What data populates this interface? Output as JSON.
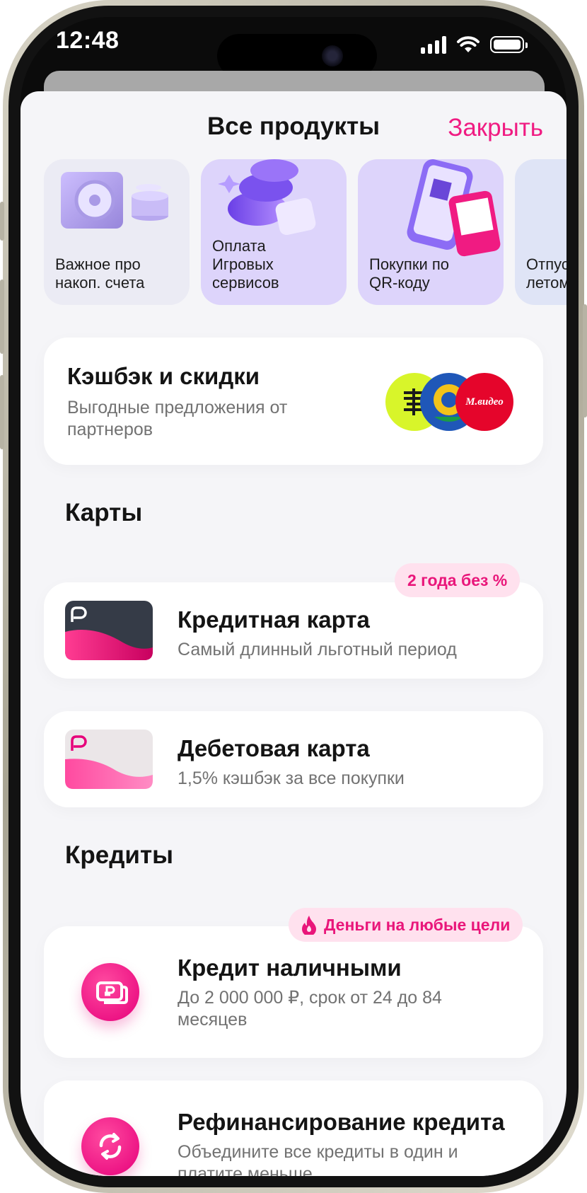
{
  "status_bar": {
    "time": "12:48"
  },
  "sheet": {
    "title": "Все продукты",
    "close_label": "Закрыть"
  },
  "stories": [
    {
      "label": "Важное про\nнакоп. счета",
      "bg": "#ebebf4"
    },
    {
      "label": "Оплата\nИгровых\nсервисов",
      "bg": "#ddd4fb"
    },
    {
      "label": "Покупки по\nQR-коду",
      "bg": "#ddd4fb"
    },
    {
      "label": "Отпуск\nлетом",
      "bg": "#dfe4f6"
    }
  ],
  "cashback": {
    "title": "Кэшбэк и скидки",
    "subtitle": "Выгодные предложения от партнеров",
    "partner_logos": [
      "partner-logo-yellow",
      "partner-logo-blue",
      "mvideo-logo"
    ],
    "mvideo_text": "М.видео"
  },
  "cards_section": {
    "heading": "Карты",
    "items": [
      {
        "title": "Кредитная карта",
        "subtitle": "Самый длинный льготный период",
        "badge": "2 года без %",
        "icon": "credit-card-image"
      },
      {
        "title": "Дебетовая карта",
        "subtitle": "1,5% кэшбэк за все покупки",
        "icon": "debit-card-image"
      }
    ]
  },
  "credits_section": {
    "heading": "Кредиты",
    "items": [
      {
        "title": "Кредит наличными",
        "subtitle": "До 2 000 000 ₽, срок от 24 до 84 месяцев",
        "badge": "Деньги на любые цели",
        "icon": "cash-ruble-icon"
      },
      {
        "title": "Рефинансирование кредита",
        "subtitle": "Объедините все кредиты в один и платите меньше",
        "icon": "refresh-icon"
      }
    ]
  },
  "colors": {
    "accent": "#f01b82",
    "badge_bg": "#ffe1ee",
    "sheet_bg": "#f5f5f8"
  }
}
